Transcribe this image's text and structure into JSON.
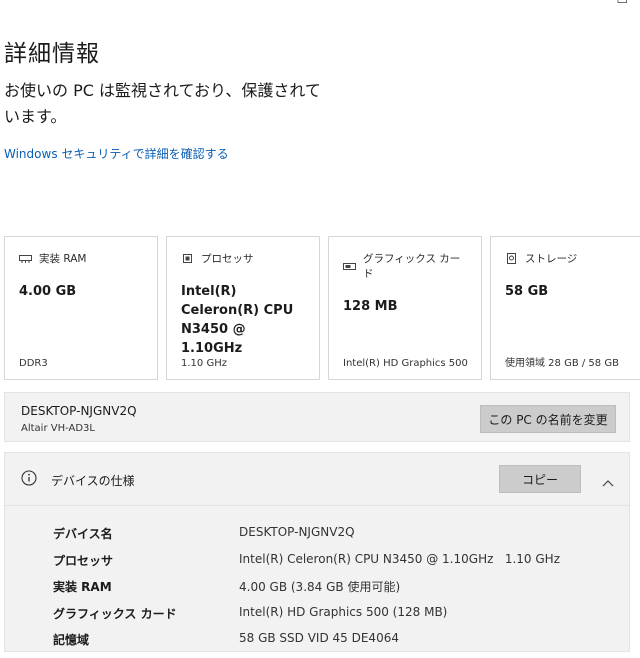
{
  "page": {
    "title": "詳細情報",
    "status_text": "お使いの PC は監視されており、保護されています。",
    "security_link": "Windows セキュリティで詳細を確認する"
  },
  "cards": [
    {
      "icon": "memory-icon",
      "label": "実装 RAM",
      "value": "4.00 GB",
      "footer": "DDR3"
    },
    {
      "icon": "processor-icon",
      "label": "プロセッサ",
      "value": "Intel(R) Celeron(R) CPU N3450 @ 1.10GHz",
      "footer": "1.10 GHz"
    },
    {
      "icon": "graphics-card-icon",
      "label": "グラフィックス カード",
      "value": "128 MB",
      "footer": "Intel(R) HD Graphics 500"
    },
    {
      "icon": "storage-icon",
      "label": "ストレージ",
      "value": "58 GB",
      "footer": "使用領域 28 GB / 58 GB"
    }
  ],
  "device": {
    "name": "DESKTOP-NJGNV2Q",
    "model": "Altair VH-AD3L",
    "rename_label": "この PC の名前を変更"
  },
  "specs": {
    "title": "デバイスの仕様",
    "copy_label": "コピー",
    "rows": [
      {
        "key": "デバイス名",
        "value": "DESKTOP-NJGNV2Q"
      },
      {
        "key": "プロセッサ",
        "value": "Intel(R) Celeron(R) CPU N3450 @ 1.10GHz   1.10 GHz"
      },
      {
        "key": "実装 RAM",
        "value": "4.00 GB (3.84 GB 使用可能)"
      },
      {
        "key": "グラフィックス カード",
        "value": "Intel(R) HD Graphics 500 (128 MB)"
      },
      {
        "key": "記憶域",
        "value": "58 GB SSD VID 45 DE4064"
      }
    ]
  },
  "colors": {
    "link": "#0a5fb4",
    "button": "#cccccc",
    "panel": "#f2f2f2"
  }
}
